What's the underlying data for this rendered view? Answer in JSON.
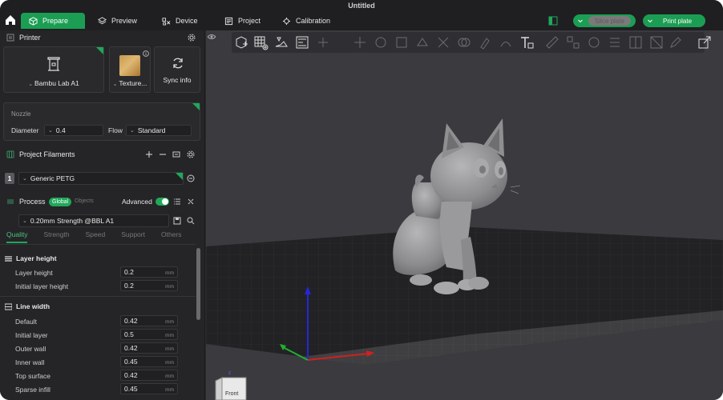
{
  "window": {
    "title": "Untitled"
  },
  "nav": {
    "tabs": [
      {
        "label": "Prepare",
        "icon": "cube-icon",
        "active": true
      },
      {
        "label": "Preview",
        "icon": "layers-icon",
        "active": false
      },
      {
        "label": "Device",
        "icon": "device-icon",
        "active": false
      },
      {
        "label": "Project",
        "icon": "project-icon",
        "active": false
      },
      {
        "label": "Calibration",
        "icon": "calibration-icon",
        "active": false
      }
    ],
    "slice_label": "Slice plate",
    "print_label": "Print plate"
  },
  "printer": {
    "header": "Printer",
    "model": "Bambu Lab A1",
    "plate": "Texture...",
    "sync": "Sync info",
    "nozzle_label": "Nozzle",
    "diameter_label": "Diameter",
    "diameter_value": "0.4",
    "flow_label": "Flow",
    "flow_value": "Standard"
  },
  "filaments": {
    "header": "Project Filaments",
    "items": [
      {
        "index": "1",
        "name": "Generic PETG"
      }
    ]
  },
  "process": {
    "header": "Process",
    "scope_global": "Global",
    "scope_objects": "Objects",
    "advanced_label": "Advanced",
    "preset": "0.20mm Strength @BBL A1",
    "tabs": [
      "Quality",
      "Strength",
      "Speed",
      "Support",
      "Others"
    ],
    "sections": [
      {
        "title": "Layer height",
        "rows": [
          {
            "label": "Layer height",
            "value": "0.2",
            "unit": "mm"
          },
          {
            "label": "Initial layer height",
            "value": "0.2",
            "unit": "mm"
          }
        ]
      },
      {
        "title": "Line width",
        "rows": [
          {
            "label": "Default",
            "value": "0.42",
            "unit": "mm"
          },
          {
            "label": "Initial layer",
            "value": "0.5",
            "unit": "mm"
          },
          {
            "label": "Outer wall",
            "value": "0.42",
            "unit": "mm"
          },
          {
            "label": "Inner wall",
            "value": "0.45",
            "unit": "mm"
          },
          {
            "label": "Top surface",
            "value": "0.42",
            "unit": "mm"
          },
          {
            "label": "Sparse infill",
            "value": "0.45",
            "unit": "mm"
          }
        ]
      }
    ]
  },
  "viewport": {
    "view_label": "Front"
  },
  "colors": {
    "accent": "#1fa85a",
    "panel": "#252528",
    "canvas": "#3a3a3f"
  }
}
